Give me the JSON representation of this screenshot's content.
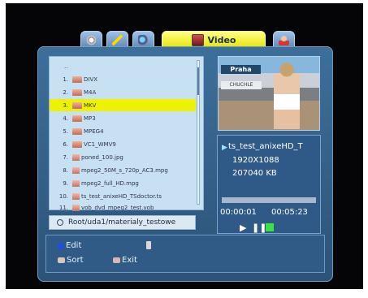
{
  "tabs": [
    {
      "icon": "gear-icon",
      "label": ""
    },
    {
      "icon": "tool-icon",
      "label": ""
    },
    {
      "icon": "satellite-icon",
      "label": ""
    },
    {
      "icon": "video-icon",
      "label": "Video"
    },
    {
      "icon": "user-icon",
      "label": ""
    }
  ],
  "list": {
    "parent_label": "..",
    "rows": [
      {
        "num": "1.",
        "name": "DIVX"
      },
      {
        "num": "2.",
        "name": "M4A"
      },
      {
        "num": "3.",
        "name": "MKV"
      },
      {
        "num": "4.",
        "name": "MP3"
      },
      {
        "num": "5.",
        "name": "MPEG4"
      },
      {
        "num": "6.",
        "name": "VC1_WMV9"
      },
      {
        "num": "7.",
        "name": "poned_100.jpg"
      },
      {
        "num": "8.",
        "name": "mpeg2_50M_s_720p_AC3.mpg"
      },
      {
        "num": "9.",
        "name": "mpeg2_full_HD.mpg"
      },
      {
        "num": "10.",
        "name": "ts_test_anixeHD_TSdoctor.ts"
      },
      {
        "num": "11.",
        "name": "vob_dvd_mpeg2_test.vob"
      }
    ],
    "path": "Root/uda1/materialy_testowe"
  },
  "preview": {
    "sign_text": "Praha",
    "sign_text2": "CHUCHLE"
  },
  "info": {
    "filename": "ts_test_anixeHD_T",
    "resolution": "1920X1088",
    "size": "207040 KB",
    "elapsed": "00:00:01",
    "total": "00:05:23"
  },
  "footer": {
    "edit_label": "Edit",
    "sort_label": "Sort",
    "exit_label": "Exit"
  }
}
